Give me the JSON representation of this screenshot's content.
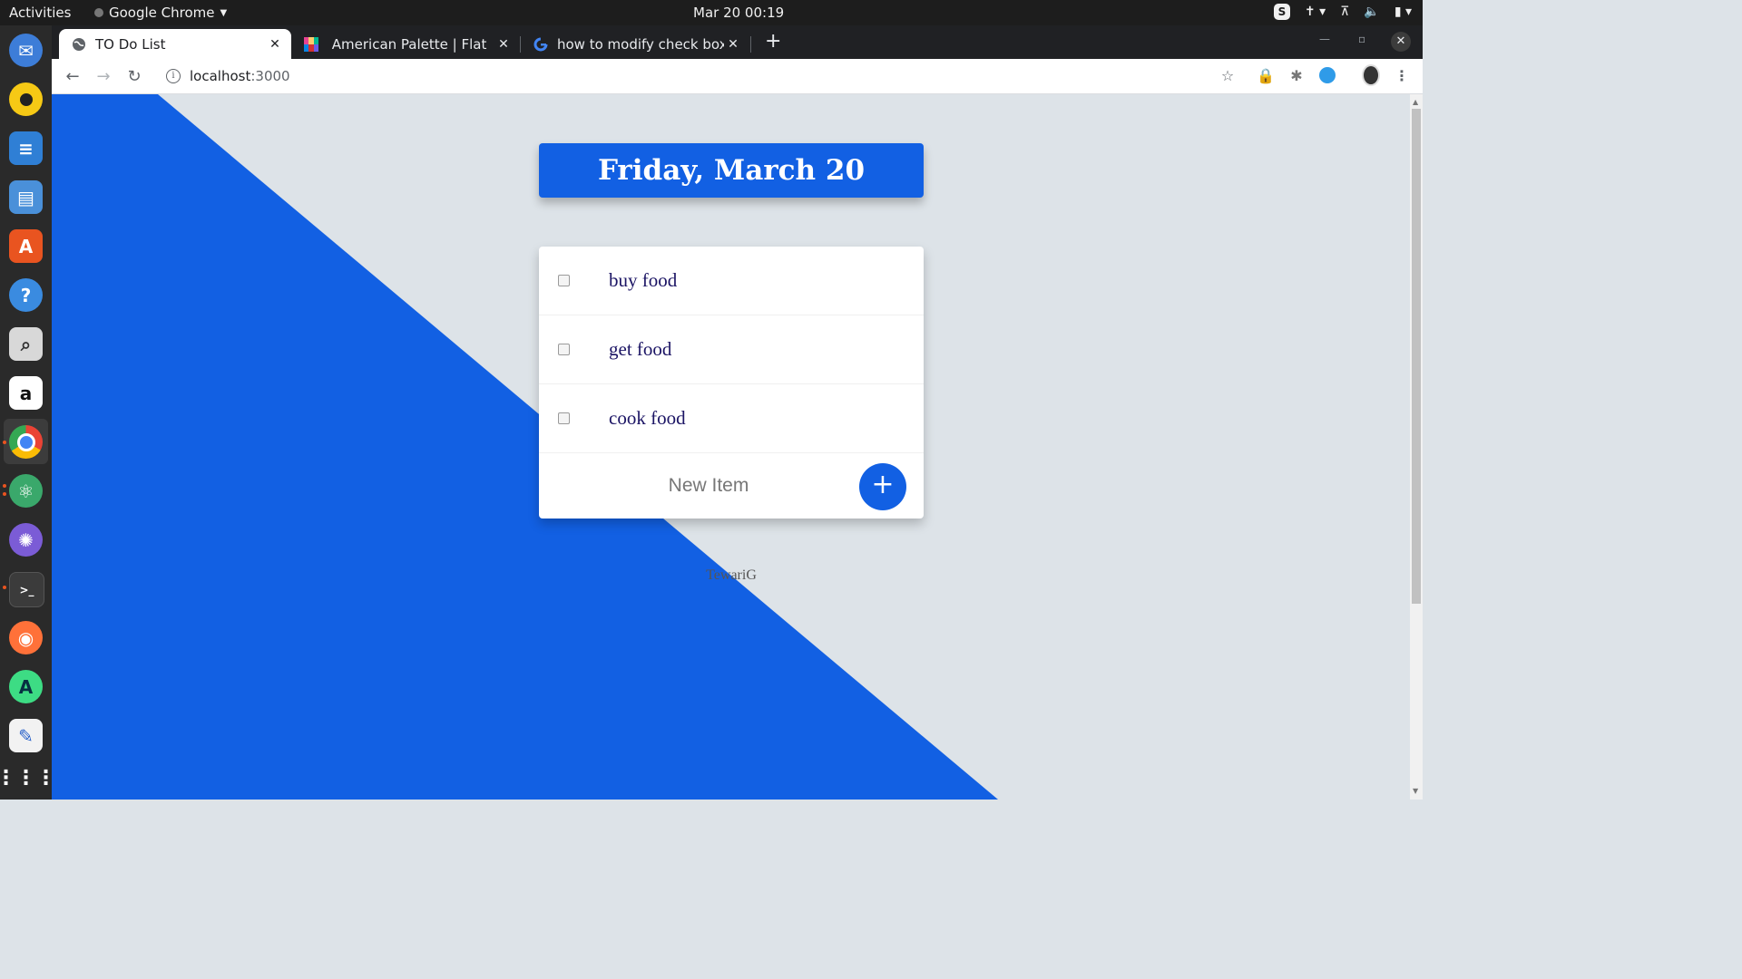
{
  "system": {
    "activities": "Activities",
    "app_name": "Google Chrome",
    "clock": "Mar 20  00:19"
  },
  "dock": {
    "apps": [
      "thunderbird-icon",
      "rhythmbox-icon",
      "writer-icon",
      "files-icon",
      "software-icon",
      "help-icon",
      "search-icon",
      "amazon-icon",
      "chrome-icon",
      "atom-icon",
      "network-icon",
      "terminal-icon",
      "firefox-icon",
      "android-studio-icon",
      "text-editor-icon",
      "app-grid-icon"
    ]
  },
  "browser": {
    "tabs": [
      {
        "title": "TO Do List",
        "active": true
      },
      {
        "title": "⁣⁣ American Palette | Flat",
        "active": false
      },
      {
        "title": "how to modify check box",
        "active": false
      }
    ],
    "url_host": "localhost",
    "url_port": ":3000"
  },
  "page": {
    "heading": "Friday, March 20",
    "items": [
      {
        "label": "buy food",
        "checked": false
      },
      {
        "label": "get food",
        "checked": false
      },
      {
        "label": "cook food",
        "checked": false
      }
    ],
    "new_item_placeholder": "New Item",
    "add_button_label": "+",
    "footer": "TewariG"
  },
  "colors": {
    "accent": "#1260e3",
    "background": "#dde3e8",
    "item_text": "#1b1464"
  }
}
